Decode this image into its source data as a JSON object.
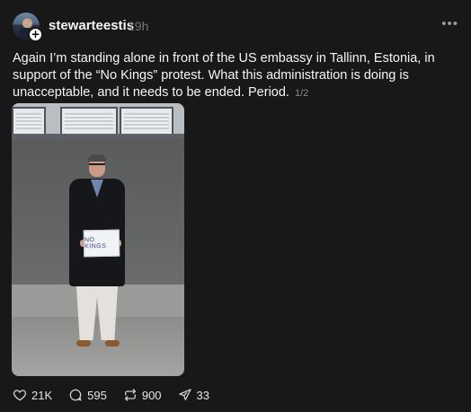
{
  "post": {
    "username": "stewarteestis",
    "timestamp": "19h",
    "more_label": "•••",
    "text": "Again I’m standing alone in front of the US embassy in Tallinn, Estonia, in support of the “No Kings” protest. What this administration is doing is unacceptable, and it needs to be ended. Period.",
    "media_counter": "1/2",
    "follow_symbol": "+",
    "sign_text": "NO KINGS"
  },
  "actions": {
    "likes": "21K",
    "comments": "595",
    "reposts": "900",
    "shares": "33"
  },
  "icons": {
    "like": "heart-icon",
    "comment": "comment-bubble-icon",
    "repost": "repost-icon",
    "share": "send-icon",
    "more": "more-dots-icon"
  },
  "colors": {
    "background": "#181818",
    "text": "#f3f5f7",
    "muted": "#777777"
  }
}
